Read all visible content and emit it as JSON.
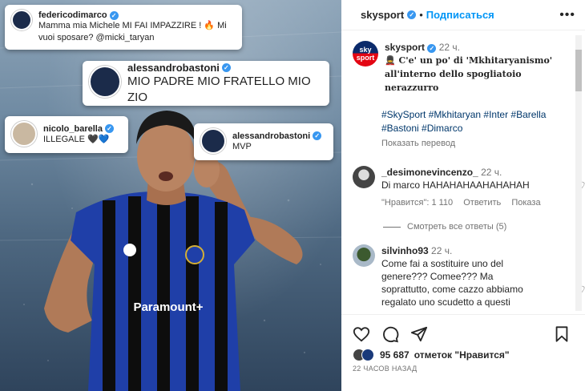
{
  "post_image": {
    "comments": [
      {
        "username": "federicodimarco",
        "text": "Mamma mia Michele MI FAI IMPAZZIRE ! 🔥 Mi vuoi sposare? @micki_taryan"
      },
      {
        "username": "alessandrobastoni",
        "text": "MIO PADRE MIO FRATELLO MIO ZIO"
      },
      {
        "username": "nicolo_barella",
        "text": "ILLEGALE 🖤💙"
      },
      {
        "username": "alessandrobastoni",
        "text": "MVP"
      }
    ],
    "jersey_sponsor": "Paramount+"
  },
  "header": {
    "username": "skysport",
    "separator": "•",
    "follow_label": "Подписаться",
    "more_label": "•••"
  },
  "caption": {
    "avatar_top": "sky",
    "avatar_bottom": "sport",
    "username": "skysport",
    "time": "22 ч.",
    "text": "💂 C'e' un po' di 'Mkhitaryanismo' all'interno dello spogliatoio nerazzurro",
    "hashtags": "#SkySport #Mkhitaryan #Inter #Barella #Bastoni #Dimarco",
    "translate_label": "Показать перевод"
  },
  "comments": [
    {
      "username": "_desimonevincenzo_",
      "time": "22 ч.",
      "text": "Di marco HAHAHAHAAHAHAHAH",
      "likes": "\"Нравится\": 1 110",
      "reply_label": "Ответить",
      "more_label": "Показа",
      "view_replies": "Смотреть все ответы (5)"
    },
    {
      "username": "silvinho93",
      "time": "22 ч.",
      "text": "Come fai a sostituire uno del genere??? Comee??? Ma soprattutto, come cazzo abbiamo regalato uno scudetto a questi"
    }
  ],
  "actions": {
    "likes_count": "95 687",
    "likes_label": "отметок \"Нравится\"",
    "time_ago": "22 ЧАСОВ НАЗАД"
  },
  "colors": {
    "accent": "#0095f6",
    "verified": "#3897f0",
    "hashtag": "#00376b",
    "inter_blue": "#1f3fa8"
  }
}
